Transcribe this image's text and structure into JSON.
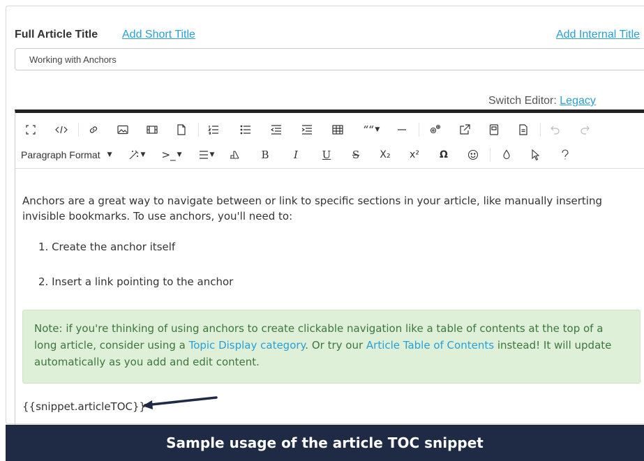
{
  "form": {
    "title_label": "Full Article Title",
    "add_short_title": "Add Short Title",
    "add_internal_title": "Add Internal Title",
    "title_value": "Working with Anchors",
    "switch_editor_label": "Switch Editor:",
    "switch_editor_link": "Legacy"
  },
  "toolbar": {
    "paragraph_format": "Paragraph Format",
    "row1_icons": [
      "fullscreen-icon",
      "code-view-icon",
      "link-icon",
      "image-icon",
      "video-icon",
      "file-icon",
      "ordered-list-icon",
      "unordered-list-icon",
      "outdent-icon",
      "indent-icon",
      "table-icon",
      "quote-icon",
      "horizontal-line-icon",
      "settings-icon",
      "open-external-icon",
      "page-icon",
      "document-icon",
      "undo-icon",
      "redo-icon"
    ],
    "row2_glyphs": {
      "bold": "B",
      "italic": "I",
      "underline": "U",
      "strikethrough": "S",
      "subscript": "X₂",
      "superscript": "x²",
      "omega": "Ω"
    }
  },
  "content": {
    "intro": "Anchors are a great way to navigate between or link to specific sections in your article, like manually inserting invisible bookmarks. To use anchors, you'll need to:",
    "step1": "1. Create the anchor itself",
    "step2": "2. Insert a link pointing to the anchor",
    "note_part1": "Note: if you're thinking of using anchors to create clickable navigation like a table of contents at the top of a long article, consider using a ",
    "note_link1": "Topic Display category",
    "note_part2": ". Or try our ",
    "note_link2": "Article Table of Contents",
    "note_part3": " instead! It will update automatically as you add and edit content.",
    "snippet": "{{snippet.articleTOC}}"
  },
  "caption": "Sample usage of the article TOC snippet",
  "colors": {
    "link": "#2a9fd6",
    "note_bg": "#dff0d8",
    "note_text": "#3c763d",
    "caption_bg": "#1f2a44"
  }
}
